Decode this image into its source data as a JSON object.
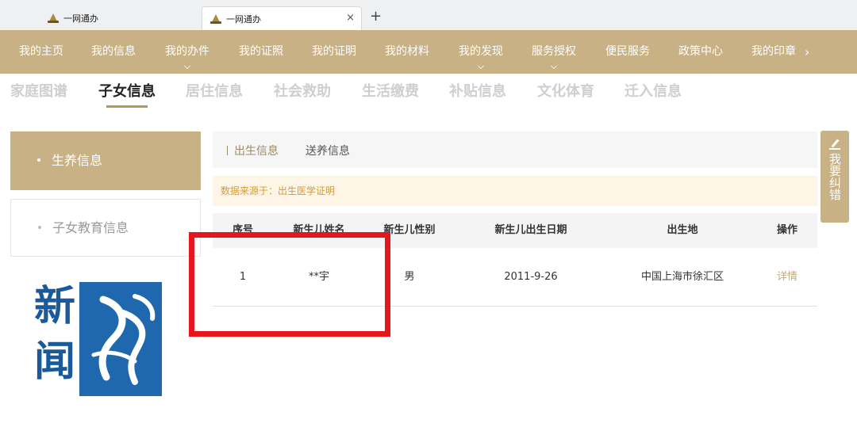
{
  "browser": {
    "tabs": [
      {
        "title": "一网通办",
        "active": false
      },
      {
        "title": "一网通办",
        "active": true
      }
    ],
    "close_glyph": "×",
    "new_tab_glyph": "+"
  },
  "nav": {
    "items": [
      {
        "label": "我的主页",
        "has_dropdown": false
      },
      {
        "label": "我的信息",
        "has_dropdown": false
      },
      {
        "label": "我的办件",
        "has_dropdown": true
      },
      {
        "label": "我的证照",
        "has_dropdown": false
      },
      {
        "label": "我的证明",
        "has_dropdown": false
      },
      {
        "label": "我的材料",
        "has_dropdown": false
      },
      {
        "label": "我的发现",
        "has_dropdown": true
      },
      {
        "label": "服务授权",
        "has_dropdown": true
      },
      {
        "label": "便民服务",
        "has_dropdown": false
      },
      {
        "label": "政策中心",
        "has_dropdown": false
      },
      {
        "label": "我的印章",
        "has_dropdown": false
      }
    ],
    "more_glyph": "›"
  },
  "category_tabs": [
    {
      "label": "家庭图谱",
      "active": false
    },
    {
      "label": "子女信息",
      "active": true
    },
    {
      "label": "居住信息",
      "active": false
    },
    {
      "label": "社会救助",
      "active": false
    },
    {
      "label": "生活缴费",
      "active": false
    },
    {
      "label": "补贴信息",
      "active": false
    },
    {
      "label": "文化体育",
      "active": false
    },
    {
      "label": "迁入信息",
      "active": false
    }
  ],
  "side_menu": {
    "items": [
      {
        "label": "生养信息",
        "active": true
      },
      {
        "label": "子女教育信息",
        "active": false
      }
    ]
  },
  "content": {
    "subtabs": [
      {
        "label": "出生信息",
        "active": true
      },
      {
        "label": "送养信息",
        "active": false
      }
    ],
    "source_note": "数据来源于：出生医学证明",
    "table": {
      "headers": [
        "序号",
        "新生儿姓名",
        "新生儿性别",
        "新生儿出生日期",
        "出生地",
        "操作"
      ],
      "rows": [
        [
          "1",
          "**宇",
          "男",
          "2011-9-26",
          "中国上海市徐汇区",
          "详情"
        ]
      ]
    }
  },
  "correction_widget": {
    "label": "我要纠错",
    "icon": "pencil-icon"
  },
  "watermark": {
    "chars": [
      "新",
      "闻"
    ],
    "brand_color": "#2068ad"
  },
  "colors": {
    "gold": "#c8b185",
    "annotation_red": "#e8161c",
    "source_text": "#d69a3a"
  }
}
